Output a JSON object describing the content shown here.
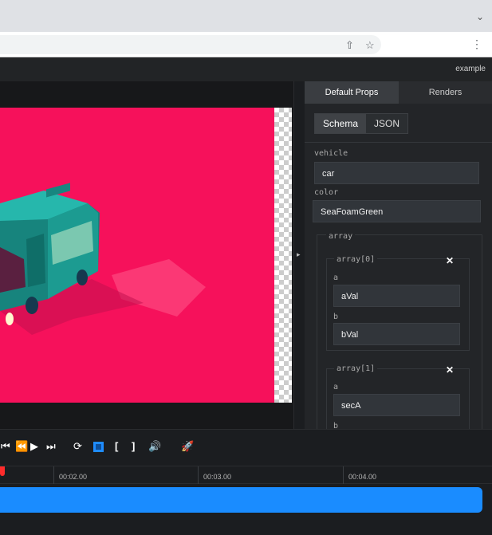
{
  "browser": {
    "icons": [
      "share-icon",
      "star-icon",
      "more-menu-icon",
      "chevron-down-icon"
    ]
  },
  "app": {
    "name": "example"
  },
  "panel": {
    "tabs": [
      "Default Props",
      "Renders"
    ],
    "subtabs": [
      "Schema",
      "JSON"
    ],
    "fields": {
      "vehicle_label": "vehicle",
      "vehicle_value": "car",
      "color_label": "color",
      "color_value": "SeaFoamGreen",
      "array_label": "array",
      "item0_label": "array[0]",
      "item0_a_label": "a",
      "item0_a_value": "aVal",
      "item0_b_label": "b",
      "item0_b_value": "bVal",
      "item1_label": "array[1]",
      "item1_a_label": "a",
      "item1_a_value": "secA",
      "item1_b_label": "b"
    },
    "close_glyph": "✕"
  },
  "timeline": {
    "labels": [
      "00:02.00",
      "00:03.00",
      "00:04.00"
    ]
  },
  "colors": {
    "canvas": "#f6115b",
    "accent": "#1a8cff",
    "playhead": "#ff2b2b",
    "van": "#1ea39a"
  }
}
